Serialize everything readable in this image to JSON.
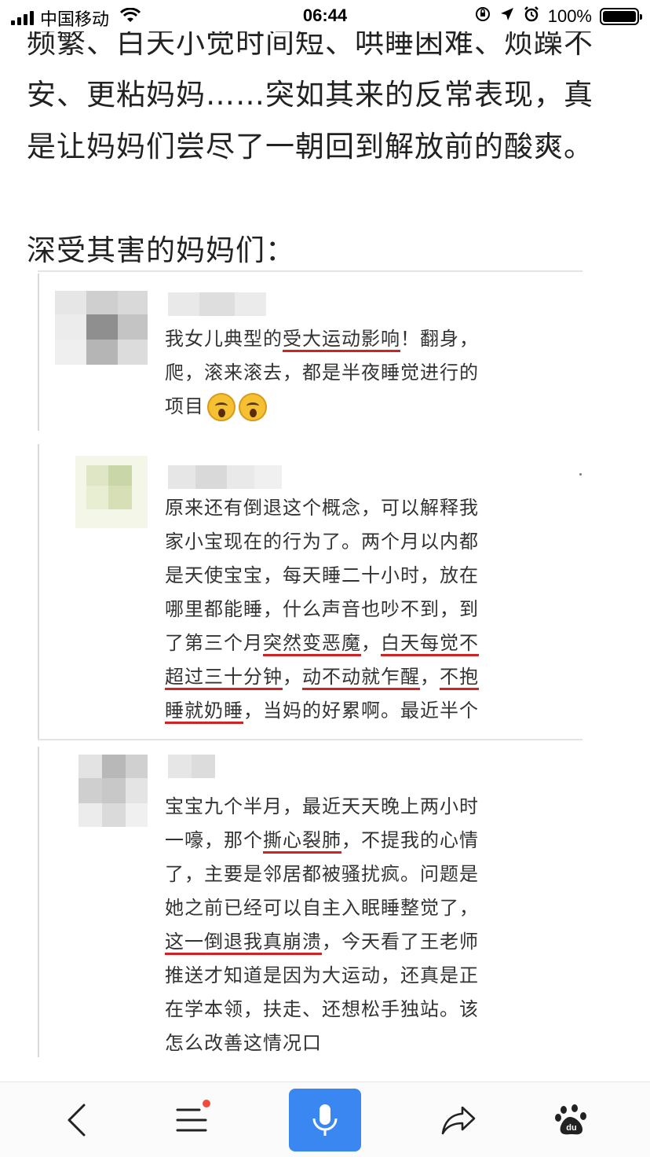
{
  "status_bar": {
    "carrier": "中国移动",
    "time": "06:44",
    "battery": "100%",
    "battery_level": 1.0
  },
  "article": {
    "lines": [
      "频繁、白天小觉时间短、哄睡困难、烦躁不",
      "安、更粘妈妈……突如其来的反常表现，真",
      "是让妈妈们尝尽了一朝回到解放前的酸爽。"
    ],
    "section_label": "深受其害的妈妈们："
  },
  "comments": [
    {
      "lines": [
        [
          "我女儿典型的",
          "受大运动影响",
          "！翻身，"
        ],
        [
          "爬，滚来滚去，都是半夜睡觉进行的"
        ],
        [
          "项目"
        ]
      ]
    },
    {
      "lines": [
        [
          "原来还有倒退这个概念，可以解释我"
        ],
        [
          "家小宝现在的行为了。两个月以内都"
        ],
        [
          "是天使宝宝，每天睡二十小时，放在"
        ],
        [
          "哪里都能睡，什么声音也吵不到，到"
        ],
        [
          "了第三个月",
          "突然变恶魔",
          "，",
          "白天每觉不"
        ],
        [
          "超过三十分钟",
          "，",
          "动不动就乍醒",
          "，",
          "不抱"
        ],
        [
          "睡就奶睡",
          "，当妈的好累啊。最近半个"
        ]
      ]
    },
    {
      "lines": [
        [
          "宝宝九个半月，最近天天晚上两小时"
        ],
        [
          "一嚎，那个",
          "撕心裂肺",
          "，不提我的心情"
        ],
        [
          "了，主要是邻居都被骚扰疯。问题是"
        ],
        [
          "她之前已经可以自主入眠睡整觉了，"
        ],
        [
          "这一倒退我真崩溃",
          "，今天看了王老师"
        ],
        [
          "推送才知道是因为大运动，还真是正"
        ],
        [
          "在学本领，扶走、还想松手独站。该"
        ],
        [
          "怎么改善这情况口"
        ]
      ]
    }
  ],
  "toolbar": {
    "icons": [
      "back-icon",
      "menu-icon",
      "mic-icon",
      "share-icon",
      "baidu-paw-icon"
    ],
    "accent": "#3b87f1",
    "badge_color": "#f24a3a"
  },
  "colors": {
    "underline": "#d02424",
    "text": "#222222"
  }
}
